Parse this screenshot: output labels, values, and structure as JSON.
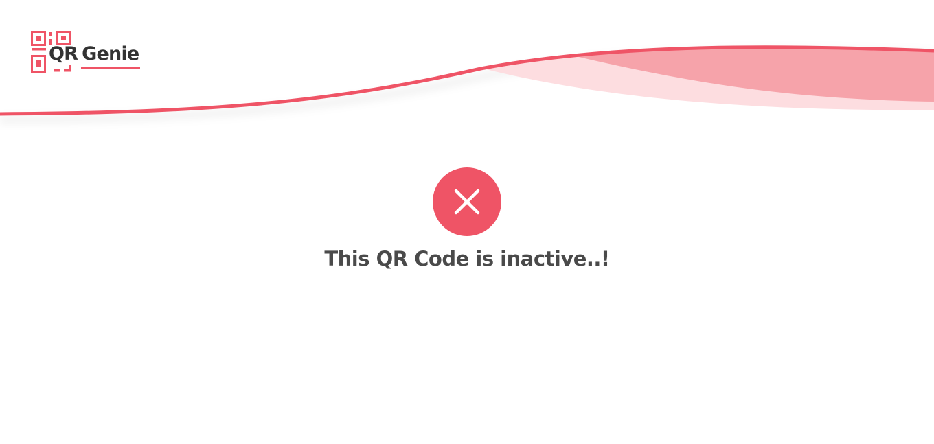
{
  "brand": {
    "name_part1": "QR",
    "name_part2": "Genie",
    "logo_icon": "qr-code-icon"
  },
  "status": {
    "icon": "close-icon",
    "message": "This QR Code is inactive..!"
  },
  "colors": {
    "accent": "#ef5466",
    "accent_light": "#f6a3aa",
    "accent_lighter": "#fddde0",
    "text_dark": "#4a4a4a",
    "background": "#ffffff"
  }
}
